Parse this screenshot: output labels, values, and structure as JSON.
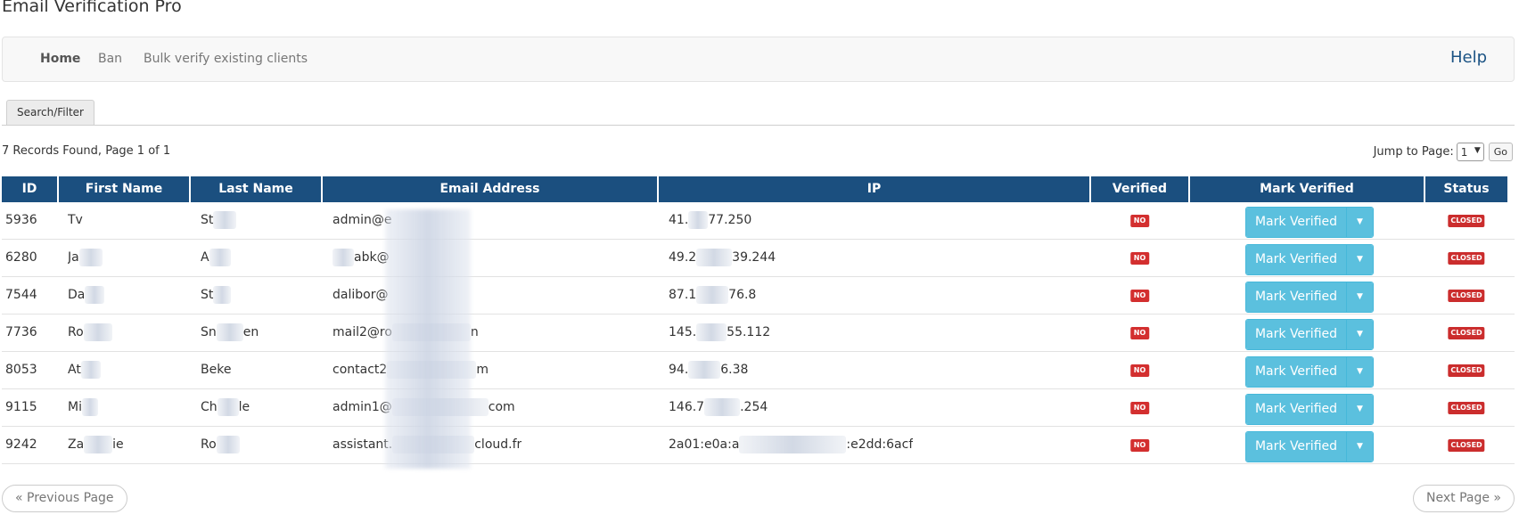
{
  "app": {
    "title": "Email Verification Pro"
  },
  "nav": {
    "items": [
      {
        "label": "Home",
        "active": true
      },
      {
        "label": "Ban",
        "active": false
      },
      {
        "label": "Bulk verify existing clients",
        "active": false
      }
    ],
    "help_label": "Help"
  },
  "filter_tab": {
    "label": "Search/Filter"
  },
  "summary": {
    "records_text": "7 Records Found, Page 1 of 1",
    "jump_label": "Jump to Page:",
    "page_selected": "1",
    "go_label": "Go"
  },
  "table": {
    "columns": [
      "ID",
      "First Name",
      "Last Name",
      "Email Address",
      "IP",
      "Verified",
      "Mark Verified",
      "Status"
    ],
    "rows": [
      {
        "id": "5936",
        "first": "Tv",
        "last": "St",
        "email": "admin@e",
        "ip": "41.",
        "ip_tail": "77.250",
        "verified": "NO",
        "action": "Mark Verified",
        "status": "CLOSED"
      },
      {
        "id": "6280",
        "first": "Ja",
        "last": "A",
        "email": "abk@",
        "ip": "49.2",
        "ip_tail": "39.244",
        "verified": "NO",
        "action": "Mark Verified",
        "status": "CLOSED"
      },
      {
        "id": "7544",
        "first": "Da",
        "last": "St",
        "email": "dalibor@",
        "ip": "87.1",
        "ip_tail": "76.8",
        "verified": "NO",
        "action": "Mark Verified",
        "status": "CLOSED"
      },
      {
        "id": "7736",
        "first": "Ro",
        "last": "Sn",
        "last_tail": "en",
        "email": "mail2@ro",
        "email_tail": "n",
        "ip": "145.",
        "ip_tail": "55.112",
        "verified": "NO",
        "action": "Mark Verified",
        "status": "CLOSED"
      },
      {
        "id": "8053",
        "first": "At",
        "last": "Beke",
        "email": "contact2",
        "email_tail": "m",
        "ip": "94.",
        "ip_tail": "6.38",
        "verified": "NO",
        "action": "Mark Verified",
        "status": "CLOSED"
      },
      {
        "id": "9115",
        "first": "Mi",
        "last": "Ch",
        "last_tail": "le",
        "email": "admin1@",
        "email_tail": "com",
        "ip": "146.7",
        "ip_tail": ".254",
        "verified": "NO",
        "action": "Mark Verified",
        "status": "CLOSED"
      },
      {
        "id": "9242",
        "first": "Za",
        "first_tail": "ie",
        "last": "Ro",
        "email": "assistant.",
        "email_tail": "cloud.fr",
        "ip": "2a01:e0a:a",
        "ip_tail": ":e2dd:6acf",
        "verified": "NO",
        "action": "Mark Verified",
        "status": "CLOSED"
      }
    ]
  },
  "pager": {
    "prev_label": "« Previous Page",
    "next_label": "Next Page »"
  },
  "colors": {
    "header_bg": "#1b4f7f",
    "button_info": "#5bc0de",
    "badge_red": "#d32f2f"
  }
}
